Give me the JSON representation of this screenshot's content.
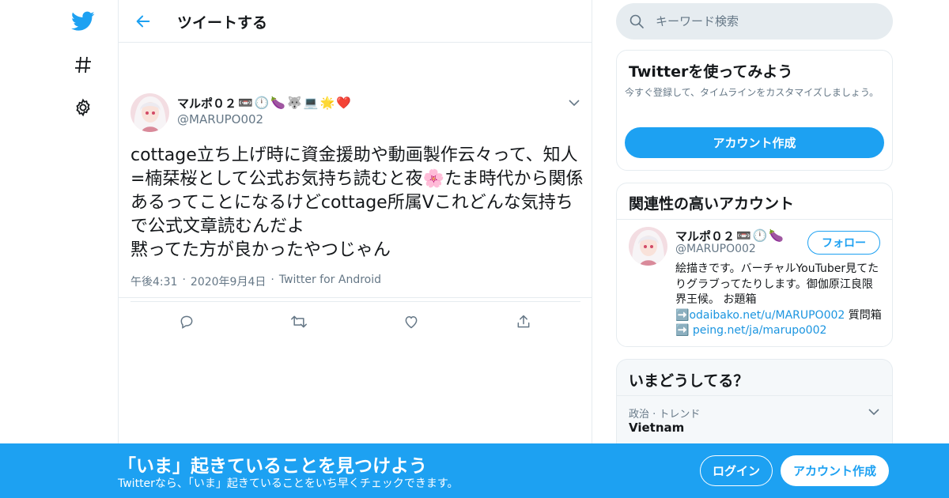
{
  "nav": {
    "icons": [
      "twitter-logo-icon",
      "explore-hashtag-icon",
      "settings-gear-icon"
    ]
  },
  "header": {
    "title": "ツイートする"
  },
  "tweet": {
    "author_name": "マルポ０２",
    "author_emojis": [
      "📼",
      "🕛",
      "🍆",
      "🐺",
      "💻",
      "🌟",
      "❤️"
    ],
    "author_handle": "@MARUPO002",
    "text": "cottage立ち上げ時に資金援助や動画製作云々って、知人=楠栞桜として公式お気持ち読むと夜🌸たま時代から関係あるってことになるけどcottage所属Vこれどんな気持ちで公式文章読むんだよ\n黙ってた方が良かったやつじゃん",
    "time": "午後4:31",
    "date": "2020年9月4日",
    "source": "Twitter for Android",
    "actions": [
      "reply-icon",
      "retweet-icon",
      "like-icon",
      "share-icon"
    ]
  },
  "search": {
    "placeholder": "キーワード検索"
  },
  "signup_card": {
    "title": "Twitterを使ってみよう",
    "subtitle": "今すぐ登録して、タイムラインをカスタマイズしましょう。",
    "button": "アカウント作成"
  },
  "related_card": {
    "title": "関連性の高いアカウント",
    "name": "マルポ０２",
    "emojis": [
      "📼",
      "🕛",
      "🍆"
    ],
    "handle": "@MARUPO002",
    "follow": "フォロー",
    "bio_text": "絵描きです。バーチャルYouTuber見てたりグラブってたりします。御伽原江良限界王候。 お題箱➡️",
    "bio_link1": "odaibako.net/u/MARUPO002",
    "bio_mid": " 質問箱 ➡️ ",
    "bio_link2": "peing.net/ja/marupo002"
  },
  "trends_card": {
    "title": "いまどうしてる？",
    "trend_category": "政治 · トレンド",
    "trend_name": "Vietnam"
  },
  "banner": {
    "title": "「いま」起きていることを見つけよう",
    "subtitle": "Twitterなら、「いま」起きていることをいち早くチェックできます。",
    "login": "ログイン",
    "signup": "アカウント作成"
  },
  "colors": {
    "brand": "#1da1f2",
    "muted": "#657786",
    "border": "#e6ecf0"
  }
}
